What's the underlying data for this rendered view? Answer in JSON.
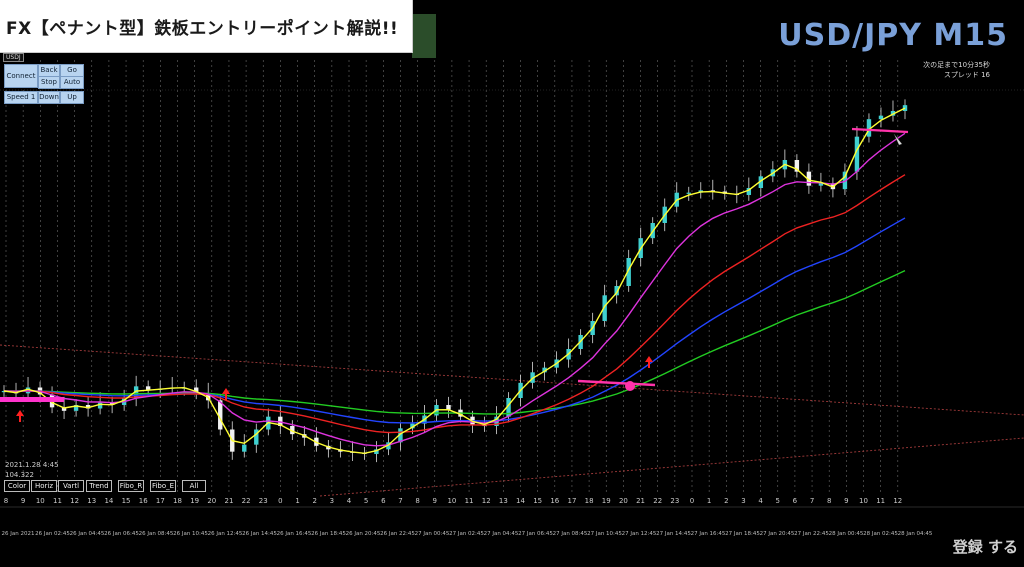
{
  "window": {
    "title": "FX【ペナント型】鉄板エントリーポイント解説!!",
    "pair": "USD/JPY M15",
    "symbol_tag": "USDJ",
    "info_line1": "次の足まで10分35秒",
    "info_line2": "スプレッド 16",
    "cursor_datetime": "2021.1.28 4:45",
    "cursor_price": "104.322",
    "watermark": "登録 する"
  },
  "button_panel": {
    "connect": "Connect",
    "back": "Back",
    "go": "Go",
    "stop": "Stop",
    "auto": "Auto",
    "speed": "Speed 1",
    "down": "Down",
    "up": "Up"
  },
  "toolbar": {
    "color": "Color",
    "horiz": "Horiz",
    "vartl": "Vartl",
    "trend": "Trend",
    "fibo_r": "Fibo_R",
    "fibo_e": "Fibo_E",
    "all": "All"
  },
  "colors": {
    "ema_fast": "#ffff33",
    "ema_mid": "#dd33dd",
    "ema_red": "#ee2222",
    "ema_blue": "#2244ff",
    "ema_green": "#22cc22",
    "candle": "#dddddd",
    "up_arrow": "#ff2020",
    "hline": "#ff33aa",
    "hour_label": "#cccccc",
    "accent_blue": "#7aa0d8"
  },
  "hour_labels": [
    "8",
    "9",
    "10",
    "11",
    "12",
    "13",
    "14",
    "15",
    "16",
    "17",
    "18",
    "19",
    "20",
    "21",
    "22",
    "23",
    "0",
    "1",
    "2",
    "3",
    "4",
    "5",
    "6",
    "7",
    "8",
    "9",
    "10",
    "11",
    "12",
    "13",
    "14",
    "15",
    "16",
    "17",
    "18",
    "19",
    "20",
    "21",
    "22",
    "23",
    "0",
    "1",
    "2",
    "3",
    "4",
    "5",
    "6",
    "7",
    "8",
    "9",
    "10",
    "11",
    "12"
  ],
  "date_labels": [
    "26 Jan 2021",
    "26 Jan 02:45",
    "26 Jan 04:45",
    "26 Jan 06:45",
    "26 Jan 08:45",
    "26 Jan 10:45",
    "26 Jan 12:45",
    "26 Jan 14:45",
    "26 Jan 16:45",
    "26 Jan 18:45",
    "26 Jan 20:45",
    "26 Jan 22:45",
    "27 Jan 00:45",
    "27 Jan 02:45",
    "27 Jan 04:45",
    "27 Jan 06:45",
    "27 Jan 08:45",
    "27 Jan 10:45",
    "27 Jan 12:45",
    "27 Jan 14:45",
    "27 Jan 16:45",
    "27 Jan 18:45",
    "27 Jan 20:45",
    "27 Jan 22:45",
    "28 Jan 00:45",
    "28 Jan 02:45",
    "28 Jan 04:45"
  ],
  "series": {
    "close": [
      105.02,
      105.0,
      105.05,
      104.99,
      104.88,
      104.85,
      104.9,
      104.87,
      104.92,
      104.9,
      104.96,
      105.06,
      105.03,
      105.04,
      105.05,
      105.05,
      105.0,
      104.94,
      104.69,
      104.5,
      104.56,
      104.69,
      104.8,
      104.72,
      104.65,
      104.62,
      104.55,
      104.52,
      104.5,
      104.49,
      104.48,
      104.52,
      104.58,
      104.7,
      104.74,
      104.81,
      104.9,
      104.86,
      104.8,
      104.73,
      104.72,
      104.8,
      104.96,
      105.09,
      105.18,
      105.22,
      105.29,
      105.38,
      105.5,
      105.62,
      105.84,
      105.92,
      106.16,
      106.33,
      106.46,
      106.6,
      106.72,
      106.72,
      106.74,
      106.73,
      106.71,
      106.7,
      106.76,
      106.86,
      106.92,
      107.0,
      106.9,
      106.78,
      106.8,
      106.75,
      106.9,
      107.2,
      107.35,
      107.38,
      107.42,
      107.47
    ]
  }
}
